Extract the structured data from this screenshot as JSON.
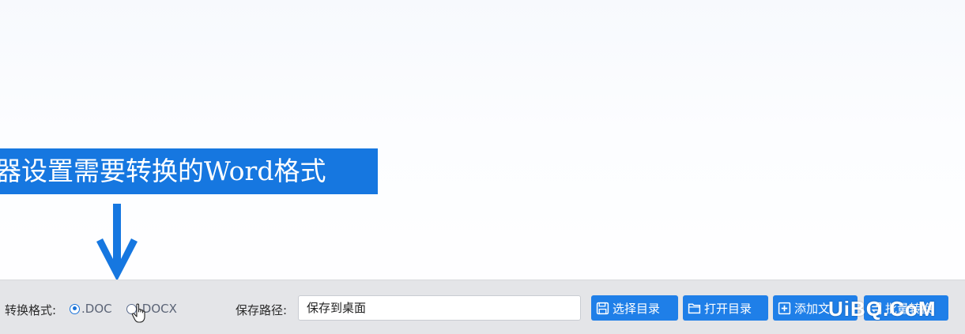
{
  "caption": {
    "text": "器设置需要转换的Word格式"
  },
  "convert": {
    "label": "转换格式:",
    "options": [
      {
        "label": ".DOC",
        "selected": true
      },
      {
        "label": ".DOCX",
        "selected": false
      }
    ]
  },
  "save": {
    "label": "保存路径:",
    "value": "保存到桌面"
  },
  "buttons": {
    "select_dir": "选择目录",
    "open_dir": "打开目录",
    "add_file": "添加文",
    "batch_convert": "批量转换"
  },
  "watermark": "UiBQ.CoM",
  "colors": {
    "accent": "#1f7fe8",
    "caption_bg": "#1677e0",
    "bar_bg": "#e4e5e8"
  }
}
